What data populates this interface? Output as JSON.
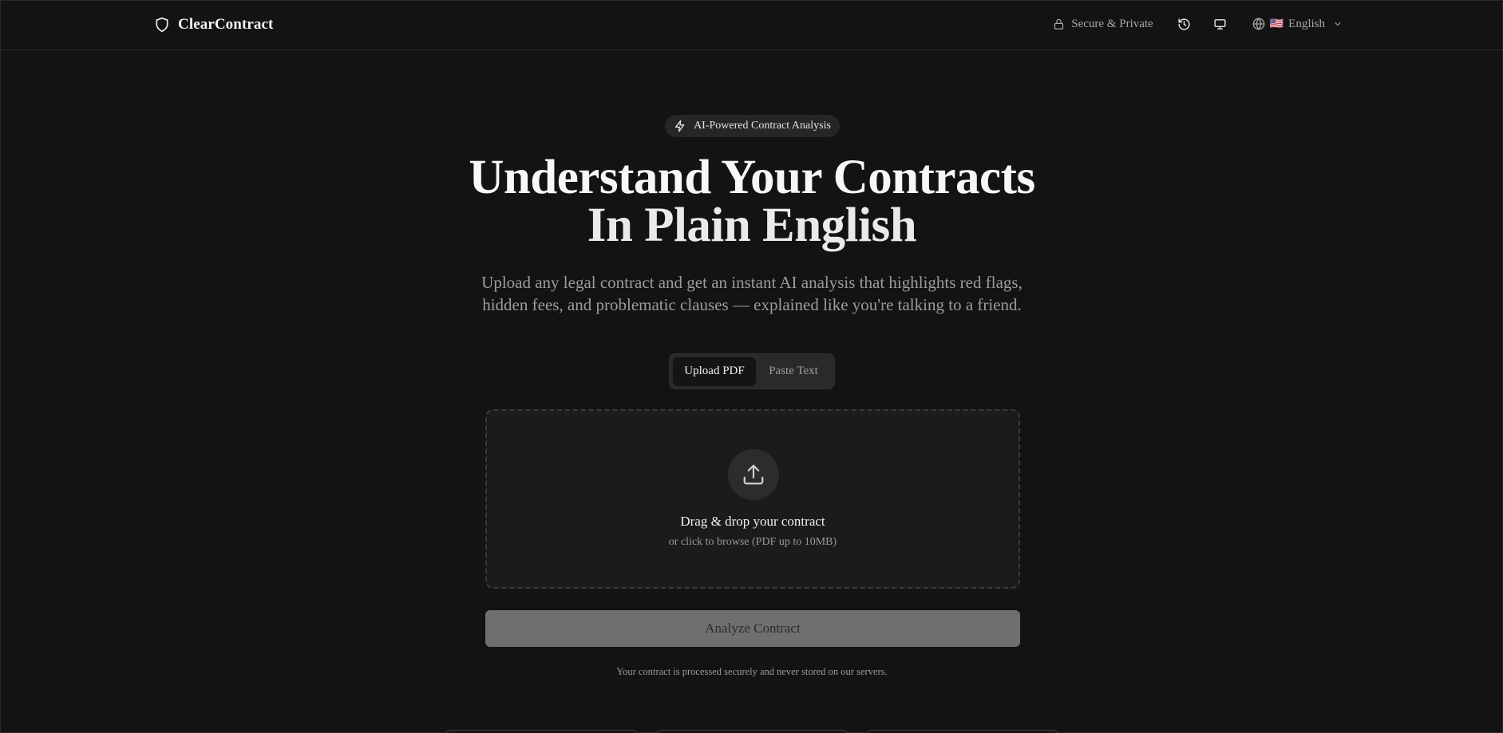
{
  "header": {
    "brand": "ClearContract",
    "secure_label": "Secure & Private",
    "language": {
      "flag": "🇺🇸",
      "label": "English"
    }
  },
  "hero": {
    "badge": "AI-Powered Contract Analysis",
    "title_line1": "Understand Your Contracts",
    "title_line2": "In Plain English",
    "subtitle_line1": "Upload any legal contract and get an instant AI analysis that highlights red flags,",
    "subtitle_line2": "hidden fees, and problematic clauses — explained like you're talking to a friend."
  },
  "tabs": [
    {
      "label": "Upload PDF",
      "active": true
    },
    {
      "label": "Paste Text",
      "active": false
    }
  ],
  "dropzone": {
    "title": "Drag & drop your contract",
    "subtitle": "or click to browse (PDF up to 10MB)"
  },
  "analyze_button": "Analyze Contract",
  "privacy_note": "Your contract is processed securely and never stored on our servers.",
  "colors": {
    "background": "#131313",
    "button_disabled": "#6f6f6f"
  }
}
